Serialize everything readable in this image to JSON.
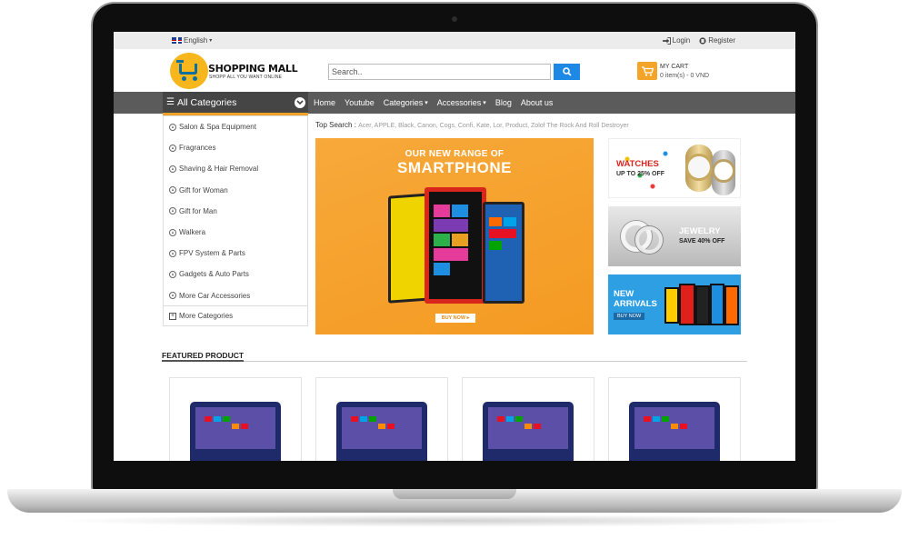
{
  "topbar": {
    "language": "English",
    "login": "Login",
    "register": "Register"
  },
  "logo": {
    "title": "SHOPPING MALL",
    "tagline": "SHOPP ALL YOU WANT ONLINE"
  },
  "search": {
    "placeholder": "Search.."
  },
  "cart": {
    "title": "MY CART",
    "summary": "0 item(s) - 0 VND"
  },
  "nav": {
    "all_categories": "All Categories",
    "menu": [
      "Home",
      "Youtube",
      "Categories",
      "Accessories",
      "Blog",
      "About us"
    ]
  },
  "sidebar": {
    "items": [
      "Salon & Spa Equipment",
      "Fragrances",
      "Shaving & Hair Removal",
      "Gift for Woman",
      "Gift for Man",
      "Walkera",
      "FPV System & Parts",
      "Gadgets & Auto Parts",
      "More Car Accessories"
    ],
    "more": "More Categories"
  },
  "top_search": {
    "label": "Top Search :",
    "terms": "Acer, APPLE, Black, Canon, Cogs, Confi, Kate, Lor, Product, Zolof The Rock And Roll Destroyer"
  },
  "main_banner": {
    "line1": "OUR NEW RANGE OF",
    "line2": "SMARTPHONE",
    "button": "BUY NOW ▸"
  },
  "side_banners": [
    {
      "title": "WATCHES",
      "sub": "UP TO 25% OFF"
    },
    {
      "title": "JEWELRY",
      "sub": "SAVE 40% OFF"
    },
    {
      "title": "NEW ARRIVALS",
      "sub": "BUY NOW"
    }
  ],
  "featured": {
    "heading": "FEATURED PRODUCT"
  },
  "colors": {
    "accent": "#f0a12a",
    "nav": "#5b5b5b",
    "search_button": "#1e88e5"
  }
}
